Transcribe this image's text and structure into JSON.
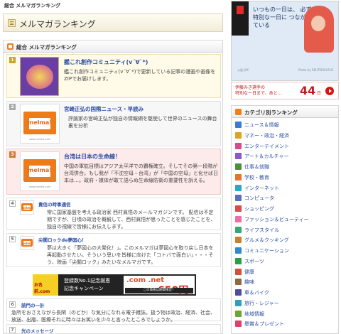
{
  "breadcrumb": "総合 メルマガランキング",
  "page_title": "メルマガランキング",
  "section_title": "総合 メルマガランキング",
  "rankings": [
    {
      "rank": "1",
      "title": "艦これ創作コミュニティ(v´∀`*)",
      "desc": "艦これ創作コミュニティ(v´∀`*)で更新している記事の漫画や画像をZIPでお届けします。"
    },
    {
      "rank": "2",
      "title": "宮崎正弘の国際ニュース・早読み",
      "desc": "評論家の宮崎正弘が独自の情報網を駆使して世界のニュースの舞台裏を分析",
      "thumb_url": "www.melma.com"
    },
    {
      "rank": "3",
      "title": "台湾は日本の生命線！",
      "desc": "中国の軍拡目標はアジア太平洋での覇権確立。そしてその第一段階が台湾併合。もし我が「不沈空母・台湾」が「中国の空母」と化せば日本は…。政府・媒体が敢て語らぬ生命線防衛の重要性を訴える。",
      "thumb_url": "www.melma.com"
    },
    {
      "rank": "4",
      "title": "貴信の時事通信",
      "desc": "常に国家基盤を考える政治家 西村眞悟のメールマガジンです。 配信は不定期ですが、日頃の政治を概観して、西村眞悟が思ったことを感じたことを、独自の視線で皆様にお伝えします。"
    },
    {
      "rank": "5",
      "title": "尖閣ロックde夢図心！",
      "desc": "夢は大きく「夢図心の大発化！」。このメルマガは夢図心を取り戻し日本を再起動させたい。そういう思いを皆様に向けた「コトバで面白い」・・・そう、映画「尖閣ロック」みたいなメルマガです。"
    },
    {
      "rank": "6",
      "title": "読門の一計",
      "desc": "急所をおさえながら長閑（のどか）な気分になれる電子雑誌。扱う物は政治、経済、社会、放送、出版、医療それに時々はお笑いを少々と言ったところでしょうか。"
    },
    {
      "rank": "7",
      "title": "光のメッセージ",
      "desc": ""
    }
  ],
  "ad": {
    "left_brand": "お名前.com",
    "text_line1": "登録数No.1記念謝恩",
    "text_line2": "記念キャンペーン",
    "domain": ".com .net",
    "price": "650円",
    "caption": "この価格は期間限定！"
  },
  "promo": {
    "text": "いつもの一日は、 必ず 特別な一日に つながっている",
    "caption": "公認 JOC",
    "credit": "Photo by REUTERS/AFLO"
  },
  "countdown": {
    "text_line1": "伊藤みき選手の",
    "text_line2": "特別な一日まで、あと…",
    "number": "44",
    "unit": "日"
  },
  "categories": {
    "title": "カテゴリ別ランキング",
    "items": [
      {
        "label": "ニュース＆情報",
        "color": "#3b7bd6"
      },
      {
        "label": "マネー・政治・経済",
        "color": "#e2a123"
      },
      {
        "label": "エンターテイメント",
        "color": "#d64b8c"
      },
      {
        "label": "アート＆カルチャー",
        "color": "#8c58c8"
      },
      {
        "label": "仕事＆就職",
        "color": "#4c8f3a"
      },
      {
        "label": "学校・教育",
        "color": "#e8742b"
      },
      {
        "label": "インターネット",
        "color": "#2fa6c8"
      },
      {
        "label": "コンピュータ",
        "color": "#5a6fbf"
      },
      {
        "label": "ショッピング",
        "color": "#d84c4c"
      },
      {
        "label": "ファッション＆ビューティー",
        "color": "#ea6fa6"
      },
      {
        "label": "ライフスタイル",
        "color": "#37a673"
      },
      {
        "label": "グルメ＆クッキング",
        "color": "#c9802a"
      },
      {
        "label": "コミュニケーション",
        "color": "#2f8bd1"
      },
      {
        "label": "スポーツ",
        "color": "#2b9e4b"
      },
      {
        "label": "健康",
        "color": "#d2503a"
      },
      {
        "label": "趣味",
        "color": "#8a6c3f"
      },
      {
        "label": "車＆バイク",
        "color": "#4e4e9e"
      },
      {
        "label": "旅行・レジャー",
        "color": "#30a0b8"
      },
      {
        "label": "地域情報",
        "color": "#6aa632"
      },
      {
        "label": "懸賞＆プレゼント",
        "color": "#e23d6b"
      }
    ]
  }
}
